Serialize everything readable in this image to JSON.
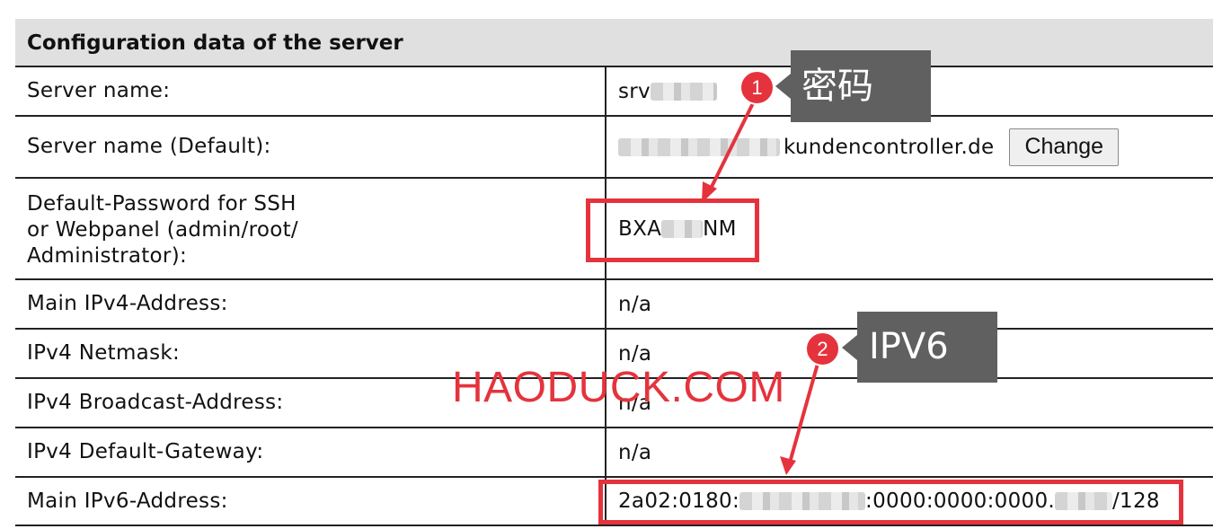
{
  "table": {
    "header": "Configuration data of the server",
    "rows": [
      {
        "label": "Server name:",
        "value_visible": "srv"
      },
      {
        "label": "Server name (Default):",
        "value_visible": "kundencontroller.de",
        "button": "Change"
      },
      {
        "label_lines": [
          "Default-Password for SSH",
          "or Webpanel (admin/root/",
          "Administrator):"
        ],
        "value_start": "BXA",
        "value_end": "NM"
      },
      {
        "label": "Main IPv4-Address:",
        "value": "n/a"
      },
      {
        "label": "IPv4 Netmask:",
        "value": "n/a"
      },
      {
        "label": "IPv4 Broadcast-Address:",
        "value": "n/a"
      },
      {
        "label": "IPv4 Default-Gateway:",
        "value": "n/a"
      },
      {
        "label": "Main IPv6-Address:",
        "value_start": "2a02:0180:",
        "value_mid": ":0000:0000:0000.",
        "value_end": "/128"
      }
    ]
  },
  "annotations": {
    "badge1": "1",
    "label1": "密码",
    "badge2": "2",
    "label2": "IPV6",
    "watermark": "HAODUCK.COM",
    "accent_color": "#e5333d",
    "tag_color": "#606060"
  }
}
